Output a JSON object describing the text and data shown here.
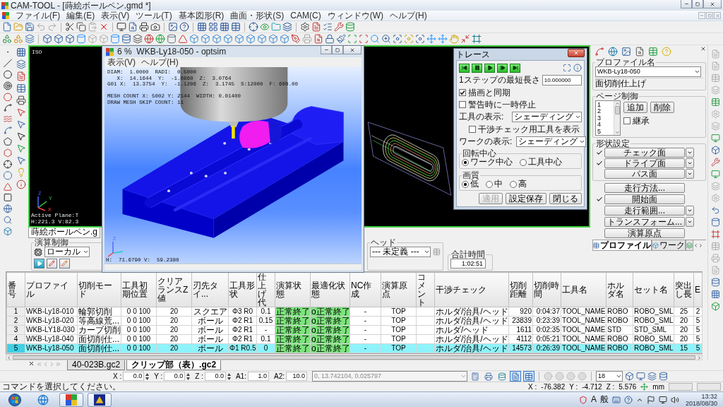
{
  "window": {
    "title": "CAM-TOOL - [蒔絵ボールペン.gmd *]"
  },
  "menu": [
    "ファイル(F)",
    "編集(E)",
    "表示(V)",
    "ツール(T)",
    "基本図形(R)",
    "曲面・形状(S)",
    "CAM(C)",
    "ウィンドウ(W)",
    "ヘルプ(H)"
  ],
  "viewport": {
    "view": "ISO",
    "axes": [
      "Z",
      "Y",
      "X"
    ],
    "active_plane": "Active Plane:T",
    "cursor": "H:221.3 V:82.3",
    "document_tab": "蒔絵ボールペン.g"
  },
  "sim_window": {
    "title": "6 %  WKB-Ly18-050 - optsim",
    "menu": [
      "表示(V)",
      "ヘルプ(H)"
    ],
    "readout": [
      "DIAM:  1.0000  RADI:  0.5000",
      "   X:  14.1644  Y:  -1.0860  Z:  3.0764",
      "G01 X:  13.3754  Y:  -1.1206  Z:  3.1745  S:12000  F: 600.00"
    ],
    "mesh": [
      "MESH COUNT X: 5002 Y: 2144  WIDTH: 0.01400",
      "DRAW MESH SKIP COUNT: 11"
    ],
    "axis": "Z",
    "cursor": "H:  71.6790 V:  59.2380"
  },
  "trace_dialog": {
    "title": "トレース",
    "step_label": "1ステップの最短長さ",
    "step_value": "10.000000",
    "sync": {
      "label": "描画と同期",
      "checked": true
    },
    "pause": {
      "label": "警告時に一時停止",
      "checked": false
    },
    "tool_display": {
      "label": "工具の表示:",
      "value": "シェーディング"
    },
    "interference_tool": {
      "label": "干渉チェック用工具を表示",
      "checked": false
    },
    "work_display": {
      "label": "ワークの表示:",
      "value": "シェーディング"
    },
    "rotation": {
      "title": "回転中心",
      "options": [
        {
          "label": "ワーク中心",
          "selected": true
        },
        {
          "label": "工具中心",
          "selected": false
        }
      ]
    },
    "quality": {
      "title": "画質",
      "options": [
        {
          "label": "低",
          "selected": true
        },
        {
          "label": "中",
          "selected": false
        },
        {
          "label": "高",
          "selected": false
        }
      ]
    },
    "buttons": [
      {
        "label": "適用",
        "disabled": true
      },
      {
        "label": "設定保存",
        "disabled": false
      },
      {
        "label": "閉じる",
        "disabled": false
      }
    ]
  },
  "profile_panel": {
    "name_group": "プロファイル名",
    "profile": "WKB-Ly18-050",
    "description": "面切削仕上げ",
    "page_group": "ページ制御",
    "pages": [
      "1",
      "2",
      "3",
      "4",
      "5"
    ],
    "add_button": "追加",
    "delete_button": "削除",
    "inherit": {
      "label": "継承",
      "checked": false
    },
    "shape_group": "形状設定",
    "shape_items": [
      {
        "label": "チェック面",
        "checked": true,
        "menu": true
      },
      {
        "label": "ドライブ面",
        "checked": true,
        "menu": true
      },
      {
        "label": "パス面",
        "checked": false,
        "menu": true
      }
    ],
    "actions": [
      {
        "label": "走行方法...",
        "checked": false,
        "menu": false
      },
      {
        "label": "開始面",
        "checked": true,
        "menu": false
      },
      {
        "label": "走行範囲...",
        "checked": false,
        "menu": true
      },
      {
        "label": "トランスフォーム...",
        "checked": false,
        "menu": true
      },
      {
        "label": "演算原点",
        "checked": false,
        "menu": false
      }
    ],
    "tabs": [
      {
        "label": "プロファイル",
        "selected": true
      },
      {
        "label": "ワーク",
        "selected": false
      }
    ]
  },
  "run_control": {
    "title": "演算制御",
    "mode": "ローカル"
  },
  "head": {
    "title": "ヘッド",
    "value": "--- 未定義 ---",
    "total_title": "合計時間",
    "total": "1:02:51"
  },
  "table": {
    "columns": [
      {
        "label": "番号",
        "kind": "index"
      },
      {
        "label": "プロファイル",
        "kind": "code"
      },
      {
        "label": "切削モード",
        "kind": "text"
      },
      {
        "label": "工具初期位置",
        "kind": "value"
      },
      {
        "label": "クリアランスZ値",
        "kind": "value"
      },
      {
        "label": "刃先タイ...",
        "kind": "tag"
      },
      {
        "label": "工具形状",
        "kind": "value"
      },
      {
        "label": "仕上げ代",
        "kind": "value"
      },
      {
        "label": "演算状態",
        "kind": "status"
      },
      {
        "label": "最適化状態",
        "kind": "status"
      },
      {
        "label": "NC作成",
        "kind": "value"
      },
      {
        "label": "演算原点",
        "kind": "value"
      },
      {
        "label": "コメント",
        "kind": "text"
      },
      {
        "label": "干渉チェック",
        "kind": "text"
      },
      {
        "label": "切削距離",
        "kind": "number"
      },
      {
        "label": "切削時間",
        "kind": "number"
      },
      {
        "label": "工具名",
        "kind": "code"
      },
      {
        "label": "ホルダ名",
        "kind": "code"
      },
      {
        "label": "セット名",
        "kind": "code"
      },
      {
        "label": "突出し長",
        "kind": "value"
      },
      {
        "label": "E",
        "kind": "value"
      }
    ],
    "rows": [
      {
        "selected": false,
        "cells": [
          "1",
          "WKB-Ly18-010",
          "輪郭切削",
          "0 0 100",
          "20",
          "スクエア",
          "Φ3 R0",
          "0.1",
          "正常終了",
          "o正常終了",
          "-",
          "TOP",
          null,
          "ホルダ/治具/ヘッド",
          "920",
          "0:04:37",
          "TOOL_NAME",
          "ROBO",
          "ROBO_SML",
          "25",
          "2"
        ]
      },
      {
        "selected": false,
        "cells": [
          "2",
          "WKB-Ly18-020",
          "等高線荒...",
          "0 0 100",
          "20",
          "ボール",
          "Φ2 R1",
          "0.15",
          "正常終了",
          "o正常終了",
          "-",
          "TOP",
          null,
          "ホルダ/治具/ヘッド",
          "23839",
          "0:23:39",
          "TOOL_NAME",
          "ROBO",
          "ROBO_SML",
          "20",
          "5"
        ]
      },
      {
        "selected": false,
        "cells": [
          "3",
          "WKB-LY18-030",
          "カーブ切削",
          "0 0 100",
          "20",
          "ボール",
          "Φ2 R1",
          "-",
          "正常終了",
          "o正常終了",
          "-",
          "TOP",
          null,
          "ホルダ/ヘッド",
          "1611",
          "0:02:35",
          "TOOL_NAME",
          "STD",
          "STD_SML",
          "20",
          "5"
        ]
      },
      {
        "selected": false,
        "cells": [
          "4",
          "WKB-Ly18-040",
          "面切削仕...",
          "0 0 100",
          "20",
          "ボール",
          "Φ2 R1",
          "0.1",
          "正常終了",
          "o正常終了",
          "-",
          "TOP",
          null,
          "ホルダ/治具/ヘッド",
          "4112",
          "0:05:21",
          "TOOL_NAME",
          "ROBO",
          "ROBO_SML",
          "20",
          "5"
        ]
      },
      {
        "selected": true,
        "cells": [
          "5",
          "WKB-Ly18-050",
          "面切削仕...",
          "0 0 100",
          "20",
          "ボール",
          "Φ1 R0.5",
          "0",
          "正常終了",
          "o正常終了",
          "-",
          "TOP",
          null,
          "ホルダ/治具/ヘッド",
          "14573",
          "0:26:39",
          "TOOL_NAME",
          "ROBO",
          "ROBO_SML",
          "15",
          "5"
        ]
      }
    ]
  },
  "sheet_tabs": [
    {
      "label": "40-023B.gc2",
      "selected": false
    },
    {
      "label": "クリップ部（表）.gc2",
      "selected": true
    }
  ],
  "coord_bar": {
    "fields": [
      {
        "label": "X :",
        "value": "0.0",
        "spin": true
      },
      {
        "label": "Y :",
        "value": "0.0",
        "spin": true
      },
      {
        "label": "Z :",
        "value": "0.0",
        "spin": true
      },
      {
        "label": "A1:",
        "value": "1.0",
        "spin": false
      },
      {
        "label": "A2:",
        "value": "10.0",
        "spin": false
      }
    ],
    "point": "0, 13.742104, 0.025797",
    "view_toggles": [
      {
        "pressed": false
      },
      {
        "pressed": false
      },
      {
        "pressed": false
      },
      {
        "pressed": true
      },
      {
        "pressed": true
      }
    ],
    "size": "18"
  },
  "status_bar": {
    "message": "コマンドを選択してください。",
    "coords": [
      {
        "label": "X :",
        "value": "-76.382"
      },
      {
        "label": "Y :",
        "value": "-4.712"
      },
      {
        "label": "Z :",
        "value": "5.576"
      }
    ],
    "unit": "mm"
  },
  "taskbar": {
    "ime_mode": "A",
    "ime_input": "般",
    "time": "13:32",
    "date": "2018/08/30"
  }
}
